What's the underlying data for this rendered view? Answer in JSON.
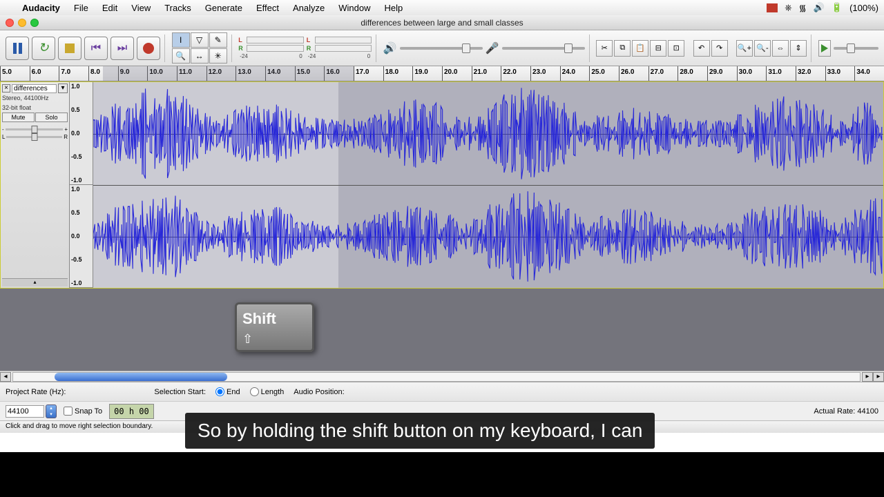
{
  "menubar": {
    "appname": "Audacity",
    "items": [
      "File",
      "Edit",
      "View",
      "Tracks",
      "Generate",
      "Effect",
      "Analyze",
      "Window",
      "Help"
    ],
    "right_battery": "(100%)"
  },
  "window": {
    "title": "differences between large and small classes"
  },
  "ruler": {
    "start": 5.0,
    "end": 35.0,
    "step": 1.0,
    "selection_start": 8.5,
    "selection_end": 17.0
  },
  "track": {
    "name": "differences",
    "format": "Stereo, 44100Hz",
    "bits": "32-bit float",
    "mute": "Mute",
    "solo": "Solo",
    "amp_labels": [
      "1.0",
      "0.5",
      "0.0",
      "-0.5",
      "-1.0"
    ]
  },
  "meter_ticks": [
    "-24",
    "0",
    "-24",
    "0"
  ],
  "shift_key": "Shift",
  "selbar": {
    "rate_label": "Project Rate (Hz):",
    "sel_start": "Selection Start:",
    "end": "End",
    "length": "Length",
    "audio_pos": "Audio Position:"
  },
  "inputs": {
    "rate_value": "44100",
    "snap": "Snap To",
    "time1": "00 h 00",
    "actual_rate": "Actual Rate: 44100"
  },
  "status": "Click and drag to move right selection boundary.",
  "caption": "So by holding the shift button on my keyboard, I can"
}
